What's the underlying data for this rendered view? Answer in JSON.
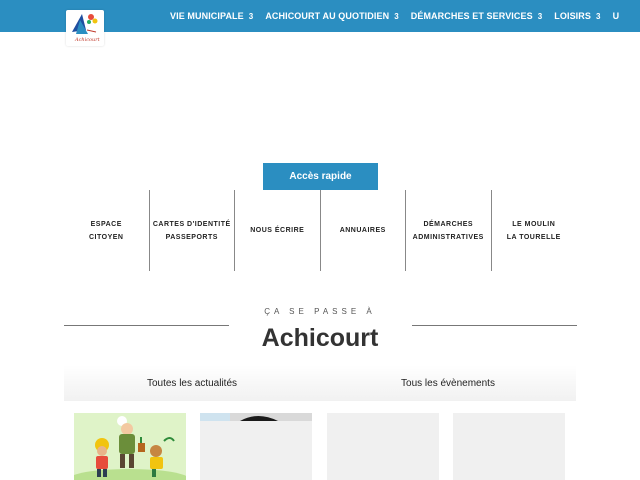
{
  "header": {
    "logo_text": "Achicourt",
    "nav": [
      {
        "label": "VIE MUNICIPALE",
        "caret": "3"
      },
      {
        "label": "ACHICOURT AU QUOTIDIEN",
        "caret": "3"
      },
      {
        "label": "DÉMARCHES ET SERVICES",
        "caret": "3"
      },
      {
        "label": "LOISIRS",
        "caret": "3"
      }
    ],
    "nav_extra": "U"
  },
  "quick_access": {
    "button_label": "Accès rapide",
    "items": [
      {
        "label": "ESPACE\nCITOYEN"
      },
      {
        "label": "CARTES D'IDENTITÉ\nPASSEPORTS"
      },
      {
        "label": "NOUS ÉCRIRE"
      },
      {
        "label": "ANNUAIRES"
      },
      {
        "label": "DÉMARCHES\nADMINISTRATIVES"
      },
      {
        "label": "LE MOULIN\nLA TOURELLE"
      }
    ]
  },
  "section": {
    "kicker": "ÇA SE PASSE À",
    "title": "Achicourt",
    "tabs": [
      {
        "label": "Toutes les actualités"
      },
      {
        "label": "Tous les évènements"
      }
    ]
  },
  "colors": {
    "brand_blue": "#2b8ec1"
  }
}
